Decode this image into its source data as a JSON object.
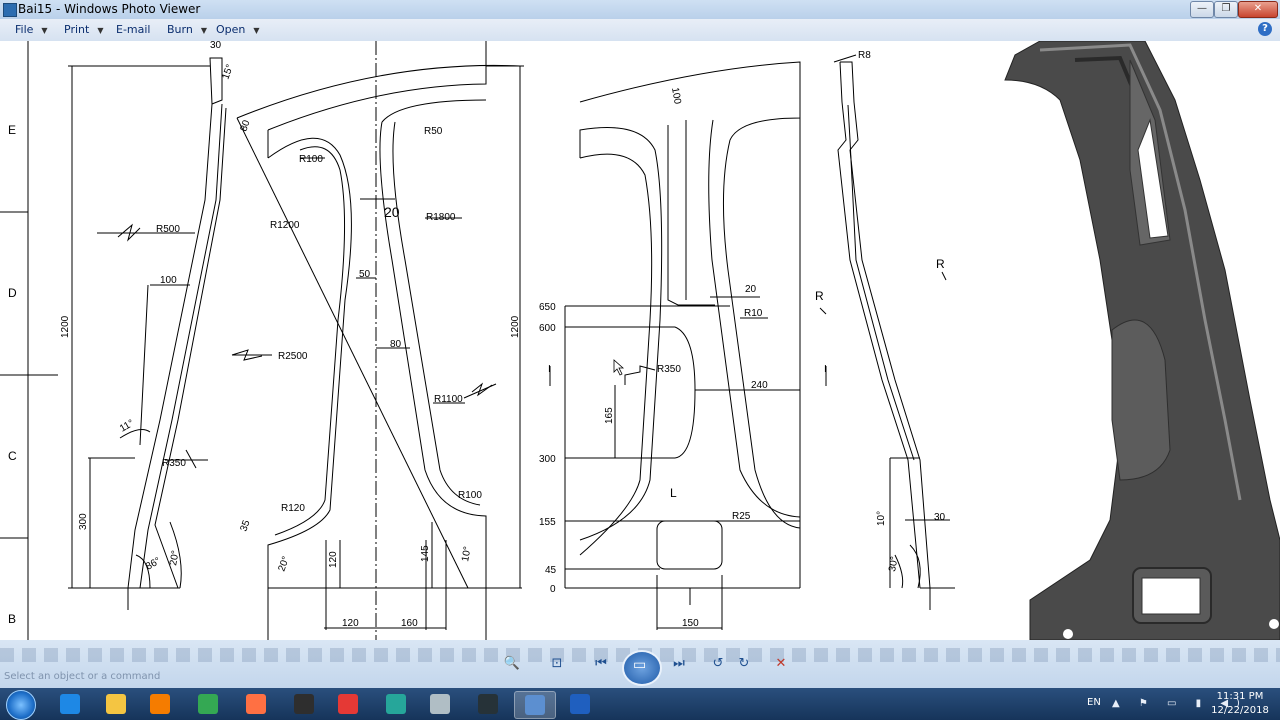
{
  "window": {
    "title": "Bai15 - Windows Photo Viewer",
    "min": "—",
    "max": "❐",
    "close": "✕"
  },
  "menu": [
    {
      "label": "File"
    },
    {
      "label": "Print"
    },
    {
      "label": "E-mail"
    },
    {
      "label": "Burn"
    },
    {
      "label": "Open"
    }
  ],
  "help_icon": "?",
  "drawing": {
    "row_labels": [
      "E",
      "D",
      "C",
      "B"
    ],
    "left_view": {
      "dims": {
        "top": "30",
        "angle_top": "15°",
        "r500": "R500",
        "w100": "100",
        "height": "1200",
        "a11": "11°",
        "r350": "R350",
        "h300": "300",
        "a86": "86°",
        "a20": "20°"
      }
    },
    "front_view": {
      "dims": {
        "d80top": "80",
        "r100a": "R100",
        "r50": "R50",
        "d20": "20",
        "r1800": "R1800",
        "r1200": "R1200",
        "d50": "50",
        "r2500": "R2500",
        "d80": "80",
        "height": "1200",
        "r1100": "R1100",
        "r120": "R120",
        "r100b": "R100",
        "d35": "35",
        "a20b": "20°",
        "h120": "120",
        "h145": "145",
        "a10": "10°",
        "w120": "120",
        "w160": "160"
      }
    },
    "section_view": {
      "scale": [
        "650",
        "600",
        "300",
        "155",
        "45",
        "0"
      ],
      "dims": {
        "d100": "100",
        "d20": "20",
        "r10": "R10",
        "r350": "R350",
        "d240": "240",
        "d165": "165",
        "l_marker": "L",
        "r25": "R25",
        "w150": "150",
        "i_marker": "I"
      }
    },
    "side_view": {
      "dims": {
        "r8": "R8",
        "r_a": "R",
        "r_b": "R",
        "i_marker": "I",
        "a10": "10°",
        "d30": "30",
        "a30": "30°"
      }
    }
  },
  "controls": {
    "status": "Select an object or a command",
    "buttons": [
      {
        "name": "zoom",
        "icon": "🔍"
      },
      {
        "name": "actual-size",
        "icon": "⊡"
      },
      {
        "name": "previous",
        "icon": "⏮"
      },
      {
        "name": "slideshow",
        "icon": "▭"
      },
      {
        "name": "next",
        "icon": "⏭"
      },
      {
        "name": "rotate-ccw",
        "icon": "↺"
      },
      {
        "name": "rotate-cw",
        "icon": "↻"
      },
      {
        "name": "delete",
        "icon": "✕"
      }
    ]
  },
  "taskbar": {
    "lang": "EN",
    "time": "11:31 PM",
    "date": "12/22/2018",
    "apps": [
      {
        "name": "ie",
        "color": "#1e88e5"
      },
      {
        "name": "explorer",
        "color": "#f4c542"
      },
      {
        "name": "media-player",
        "color": "#f57c00"
      },
      {
        "name": "chrome",
        "color": "#34a853"
      },
      {
        "name": "app-orange",
        "color": "#ff7043"
      },
      {
        "name": "3ds-max",
        "color": "#2e2e2e"
      },
      {
        "name": "app-network",
        "color": "#e53935"
      },
      {
        "name": "app-solidworks",
        "color": "#26a69a"
      },
      {
        "name": "app-tool",
        "color": "#b0bec5"
      },
      {
        "name": "app-dark",
        "color": "#263238"
      },
      {
        "name": "photo-viewer",
        "color": "#5c8fd0"
      },
      {
        "name": "word",
        "color": "#1f5fbf"
      }
    ]
  }
}
